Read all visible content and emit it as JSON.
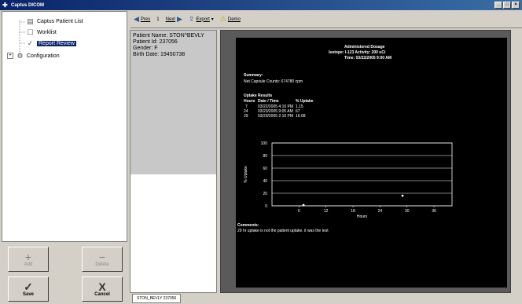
{
  "window": {
    "title": "Captus DICOM"
  },
  "tree": {
    "items": [
      {
        "label": "Captus Patient List",
        "icon": "patient-list-icon"
      },
      {
        "label": "Worklist",
        "icon": "worklist-icon"
      },
      {
        "label": "Report Review",
        "icon": "report-review-icon",
        "selected": true
      },
      {
        "label": "Configuration",
        "icon": "configuration-icon",
        "expander": "+"
      }
    ]
  },
  "actions": {
    "add": "Add",
    "delete": "Delete",
    "save": "Save",
    "cancel": "Cancel"
  },
  "toolbar": {
    "prev": "Prev",
    "page_indicator": "1",
    "next": "Next",
    "export": "Export",
    "demo": "Demo"
  },
  "patient": {
    "name": "Patient Name: STON^BEVLY",
    "id": "Patient Id: 237056",
    "gender": "Gender: F",
    "birth_date": "Birth Date: 19450738"
  },
  "report": {
    "heading": "Administered Dosage",
    "isotope_line": "Isotope: I-123   Activity: 200 uCi",
    "time_line": "Time: 03/22/2005 9:00 AM",
    "summary_title": "Summary:",
    "summary_text": "Net Capsule Counts: 674780 cpm",
    "uptake_title": "Uptake Results",
    "uptake_headers": [
      "Hours",
      "Date / Time",
      "% Uptake"
    ],
    "uptake_rows": [
      [
        "7",
        "03/22/2005 4:10 PM",
        "1.15"
      ],
      [
        "24",
        "03/23/2005 9:05 AM",
        "67"
      ],
      [
        "29",
        "03/23/2005 2:10 PM",
        "16.08"
      ]
    ],
    "comments_title": "Comments:",
    "comments_text": "29 hr uptake is not the patient uptake. it was the test"
  },
  "chart_data": {
    "type": "scatter",
    "ylabel": "% Uptake",
    "xlabel": "Hours",
    "y_ticks": [
      "100",
      "80",
      "60",
      "40",
      "20",
      "0"
    ],
    "x_ticks": [
      "6",
      "12",
      "18",
      "24",
      "30",
      "36"
    ],
    "xlim": [
      0,
      40
    ],
    "ylim": [
      0,
      100
    ],
    "grid": true,
    "points": [
      {
        "x": 7,
        "y": 1.15
      },
      {
        "x": 29,
        "y": 16.08
      }
    ]
  },
  "status": {
    "tab": "STON_BEVLY 237056"
  }
}
